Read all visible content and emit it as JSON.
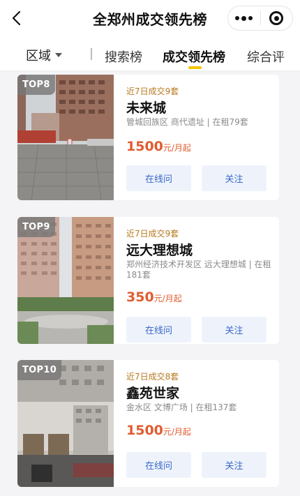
{
  "header": {
    "title": "全郑州成交领先榜"
  },
  "tabs": {
    "region": "区域",
    "items": [
      "搜索榜",
      "成交领先榜",
      "综合评"
    ],
    "active_index": 1
  },
  "cards": [
    {
      "rank": "TOP8",
      "deals": "近7日成交9套",
      "name": "未来城",
      "meta": "管城回族区 商代遗址 | 在租79套",
      "price": "1500",
      "price_unit": "元/月起",
      "btn_inquire": "在线问",
      "btn_follow": "关注"
    },
    {
      "rank": "TOP9",
      "deals": "近7日成交9套",
      "name": "远大理想城",
      "meta": "郑州经济技术开发区 远大理想城 | 在租181套",
      "price": "350",
      "price_unit": "元/月起",
      "btn_inquire": "在线问",
      "btn_follow": "关注"
    },
    {
      "rank": "TOP10",
      "deals": "近7日成交8套",
      "name": "鑫苑世家",
      "meta": "金水区 文博广场 | 在租137套",
      "price": "1500",
      "price_unit": "元/月起",
      "btn_inquire": "在线问",
      "btn_follow": "关注"
    }
  ],
  "colors": {
    "accent_underline": "#f5c400",
    "price": "#e05c2f",
    "deals": "#b7791f",
    "button_text": "#3867c9",
    "button_bg": "#eef3fb"
  }
}
